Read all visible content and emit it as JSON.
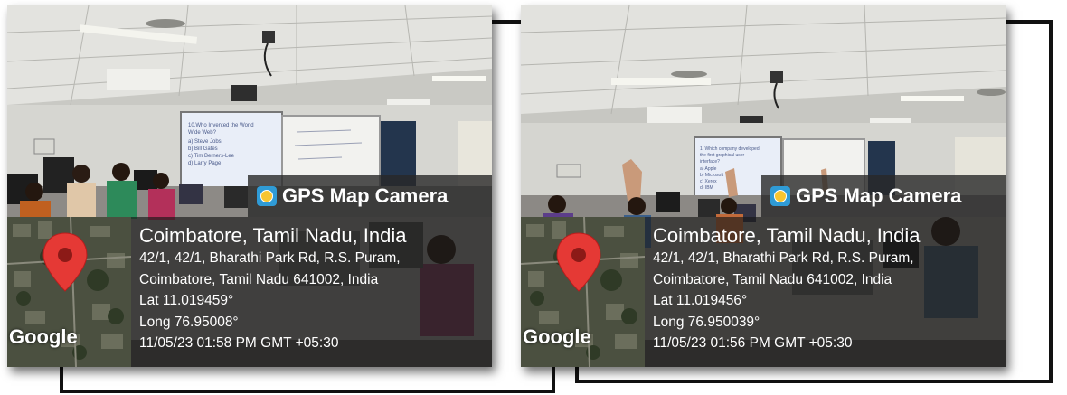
{
  "photos": [
    {
      "id": "left",
      "slide_text": "10.Who Invented the World Wide Web?\na) Steve Jobs\nb) Bill Gates\nc) Tim Berners-Lee\nd) Larry Page",
      "stamp": {
        "app_name": "GPS Map Camera",
        "city_line": "Coimbatore, Tamil Nadu, India",
        "address_line1": "42/1, 42/1, Bharathi Park Rd, R.S. Puram,",
        "address_line2": "Coimbatore, Tamil Nadu 641002, India",
        "lat": "Lat 11.019459°",
        "long": "Long 76.95008°",
        "datetime": "11/05/23 01:58 PM GMT +05:30",
        "map_label": "Google"
      }
    },
    {
      "id": "right",
      "slide_text": "1. Which company developed the first graphical user interface?\na) Apple\nb) Microsoft\nc) Xerox\nd) IBM",
      "stamp": {
        "app_name": "GPS Map Camera",
        "city_line": "Coimbatore, Tamil Nadu, India",
        "address_line1": "42/1, 42/1, Bharathi Park Rd, R.S. Puram,",
        "address_line2": "Coimbatore, Tamil Nadu 641002, India",
        "lat": "Lat 11.019456°",
        "long": "Long 76.950039°",
        "datetime": "11/05/23 01:56 PM GMT +05:30",
        "map_label": "Google"
      }
    }
  ],
  "colors": {
    "stamp_background": "#282828",
    "pin": "#e53935",
    "app_logo": "#2f9bd6",
    "connector": "#111111"
  }
}
